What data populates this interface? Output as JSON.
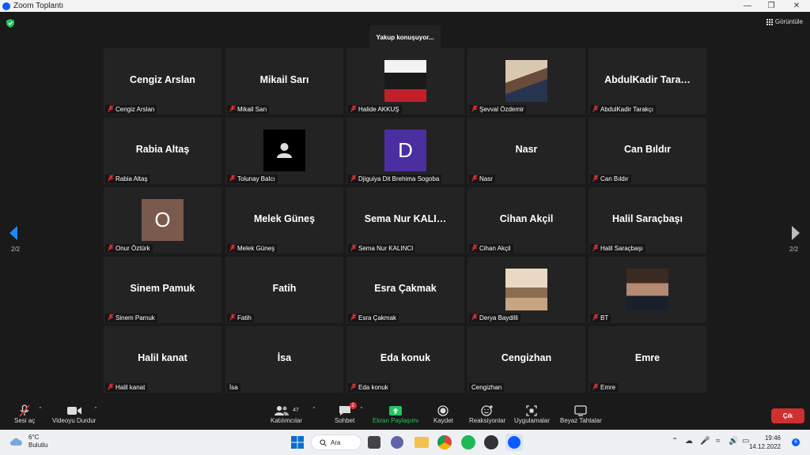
{
  "window": {
    "title": "Zoom Toplantı"
  },
  "header": {
    "speaking": "Yakup konuşuyor...",
    "view_label": "Görüntüle"
  },
  "pager": {
    "left": "2/2",
    "right": "2/2"
  },
  "tiles": [
    {
      "display": "Cengiz Arslan",
      "label": "Cengiz Arslan",
      "kind": "name"
    },
    {
      "display": "Mikail Sarı",
      "label": "Mikail Sarı",
      "kind": "name"
    },
    {
      "display": "",
      "label": "Halide AKKUŞ",
      "kind": "photo-a"
    },
    {
      "display": "",
      "label": "Şevval Özdemir",
      "kind": "photo-b"
    },
    {
      "display": "AbdulKadir Tara…",
      "label": "AbdulKadir Tarakçı",
      "kind": "name"
    },
    {
      "display": "Rabia Altaş",
      "label": "Rabia Altaş",
      "kind": "name"
    },
    {
      "display": "",
      "label": "Tolunay Balcı",
      "kind": "default-avatar"
    },
    {
      "display": "D",
      "label": "Djiguiya Dit Brehima Sogoba",
      "kind": "letter",
      "color": "#4b2ea0"
    },
    {
      "display": "Nasr",
      "label": "Nasr",
      "kind": "name"
    },
    {
      "display": "Can Bıldır",
      "label": "Can Bıldır",
      "kind": "name"
    },
    {
      "display": "O",
      "label": "Onur Öztürk",
      "kind": "letter",
      "color": "#7a5a4c"
    },
    {
      "display": "Melek Güneş",
      "label": "Melek Güneş",
      "kind": "name"
    },
    {
      "display": "Sema Nur KALI…",
      "label": "Sema Nur KALINCI",
      "kind": "name"
    },
    {
      "display": "Cihan Akçil",
      "label": "Cihan Akçil",
      "kind": "name"
    },
    {
      "display": "Halil Saraçbaşı",
      "label": "Halil Saraçbaşı",
      "kind": "name"
    },
    {
      "display": "Sinem Pamuk",
      "label": "Sinem Pamuk",
      "kind": "name"
    },
    {
      "display": "Fatih",
      "label": "Fatih",
      "kind": "name"
    },
    {
      "display": "Esra Çakmak",
      "label": "Esra Çakmak",
      "kind": "name"
    },
    {
      "display": "",
      "label": "Derya Baydilli",
      "kind": "photo-c"
    },
    {
      "display": "",
      "label": "BT",
      "kind": "photo-d"
    },
    {
      "display": "Halil kanat",
      "label": "Halil kanat",
      "kind": "name"
    },
    {
      "display": "İsa",
      "label": "İsa",
      "kind": "name",
      "nomic": true
    },
    {
      "display": "Eda konuk",
      "label": "Eda konuk",
      "kind": "name"
    },
    {
      "display": "Cengizhan",
      "label": "Cengizhan",
      "kind": "name",
      "nomic": true
    },
    {
      "display": "Emre",
      "label": "Emre",
      "kind": "name"
    }
  ],
  "toolbar": {
    "unmute": "Sesi aç",
    "stop_video": "Videoyu Durdur",
    "participants": "Katılımcılar",
    "participants_count": "47",
    "chat": "Sohbet",
    "chat_badge": "2",
    "share": "Ekran Paylaşımı",
    "record": "Kaydet",
    "reactions": "Reaksiyonlar",
    "apps": "Uygulamalar",
    "whiteboard": "Beyaz Tahtalar",
    "leave": "Çık",
    "share_color": "#22c55e",
    "leave_color": "#d02f2f"
  },
  "taskbar": {
    "temp": "6°C",
    "condition": "Bulutlu",
    "search": "Ara",
    "time": "19:46",
    "date": "14.12.2022",
    "notifications": "6"
  }
}
